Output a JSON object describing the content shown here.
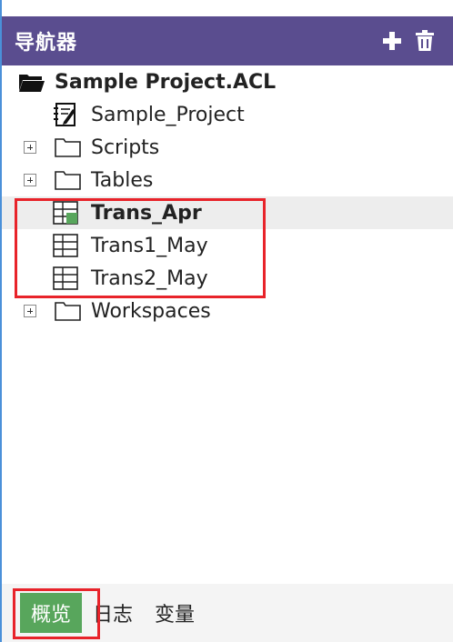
{
  "header": {
    "title": "导航器",
    "add_icon": "plus-icon",
    "delete_icon": "trash-icon"
  },
  "tree": {
    "root": {
      "label": "Sample Project.ACL",
      "icon": "open-folder-icon"
    },
    "items": [
      {
        "label": "Sample_Project",
        "icon": "script-icon"
      },
      {
        "label": "Scripts",
        "icon": "folder-icon"
      },
      {
        "label": "Tables",
        "icon": "folder-icon"
      },
      {
        "label": "Trans_Apr",
        "icon": "table-active-icon"
      },
      {
        "label": "Trans1_May",
        "icon": "table-icon"
      },
      {
        "label": "Trans2_May",
        "icon": "table-icon"
      },
      {
        "label": "Workspaces",
        "icon": "folder-icon"
      }
    ]
  },
  "tabs": [
    {
      "label": "概览"
    },
    {
      "label": "日志"
    },
    {
      "label": "变量"
    }
  ],
  "colors": {
    "header_bg": "#5a4d8f",
    "highlight": "#e8232a",
    "active_tab": "#58a65c"
  }
}
